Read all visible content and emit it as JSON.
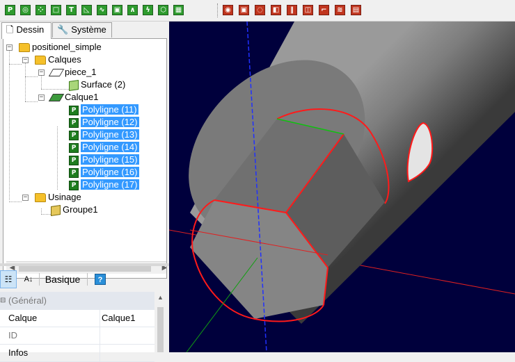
{
  "toolbar": {
    "group1": [
      {
        "name": "polyline-tool-icon",
        "glyph": "P"
      },
      {
        "name": "circle-tool-icon",
        "glyph": "◎"
      },
      {
        "name": "points-tool-icon",
        "glyph": "⁘"
      },
      {
        "name": "rectangle-tool-icon",
        "glyph": "□"
      },
      {
        "name": "text-tool-icon",
        "glyph": "T"
      },
      {
        "name": "arc-tool-icon",
        "glyph": "◺"
      },
      {
        "name": "curve-tool-icon",
        "glyph": "∿"
      },
      {
        "name": "solid-tool-icon",
        "glyph": "▣"
      },
      {
        "name": "wave-tool-icon",
        "glyph": "∧"
      },
      {
        "name": "lightning-tool-icon",
        "glyph": "ϟ"
      },
      {
        "name": "hexagon-tool-icon",
        "glyph": "⬡"
      },
      {
        "name": "grid-tool-icon",
        "glyph": "▦"
      }
    ],
    "group2": [
      {
        "name": "pocket-op-icon",
        "glyph": "◉"
      },
      {
        "name": "contour-op-icon",
        "glyph": "▣"
      },
      {
        "name": "spiral-op-icon",
        "glyph": "◌"
      },
      {
        "name": "box-op-icon",
        "glyph": "◧"
      },
      {
        "name": "drill-op-icon",
        "glyph": "‖"
      },
      {
        "name": "slot-op-icon",
        "glyph": "◫"
      },
      {
        "name": "corner-op-icon",
        "glyph": "⌐"
      },
      {
        "name": "engrave-op-icon",
        "glyph": "≋"
      },
      {
        "name": "lines-op-icon",
        "glyph": "▤"
      }
    ]
  },
  "tabs": {
    "dessin": "Dessin",
    "systeme": "Système"
  },
  "tree": {
    "root": "positionel_simple",
    "calques": "Calques",
    "piece": "piece_1",
    "surface": "Surface (2)",
    "calque1": "Calque1",
    "polylignes": [
      "Polyligne (11)",
      "Polyligne (12)",
      "Polyligne (13)",
      "Polyligne (14)",
      "Polyligne (15)",
      "Polyligne (16)",
      "Polyligne (17)"
    ],
    "usinage": "Usinage",
    "groupe": "Groupe1"
  },
  "props": {
    "basique_label": "Basique",
    "category": "(Général)",
    "rows": [
      {
        "key": "Calque",
        "value": "Calque1"
      },
      {
        "key": "ID",
        "value": ""
      },
      {
        "key": "Infos",
        "value": ""
      }
    ]
  },
  "colors": {
    "viewport_bg": "#00003c",
    "selection": "#3399ff",
    "edge_red": "#ff1a1a",
    "axis_blue": "#2030ff",
    "axis_green": "#10c010"
  }
}
